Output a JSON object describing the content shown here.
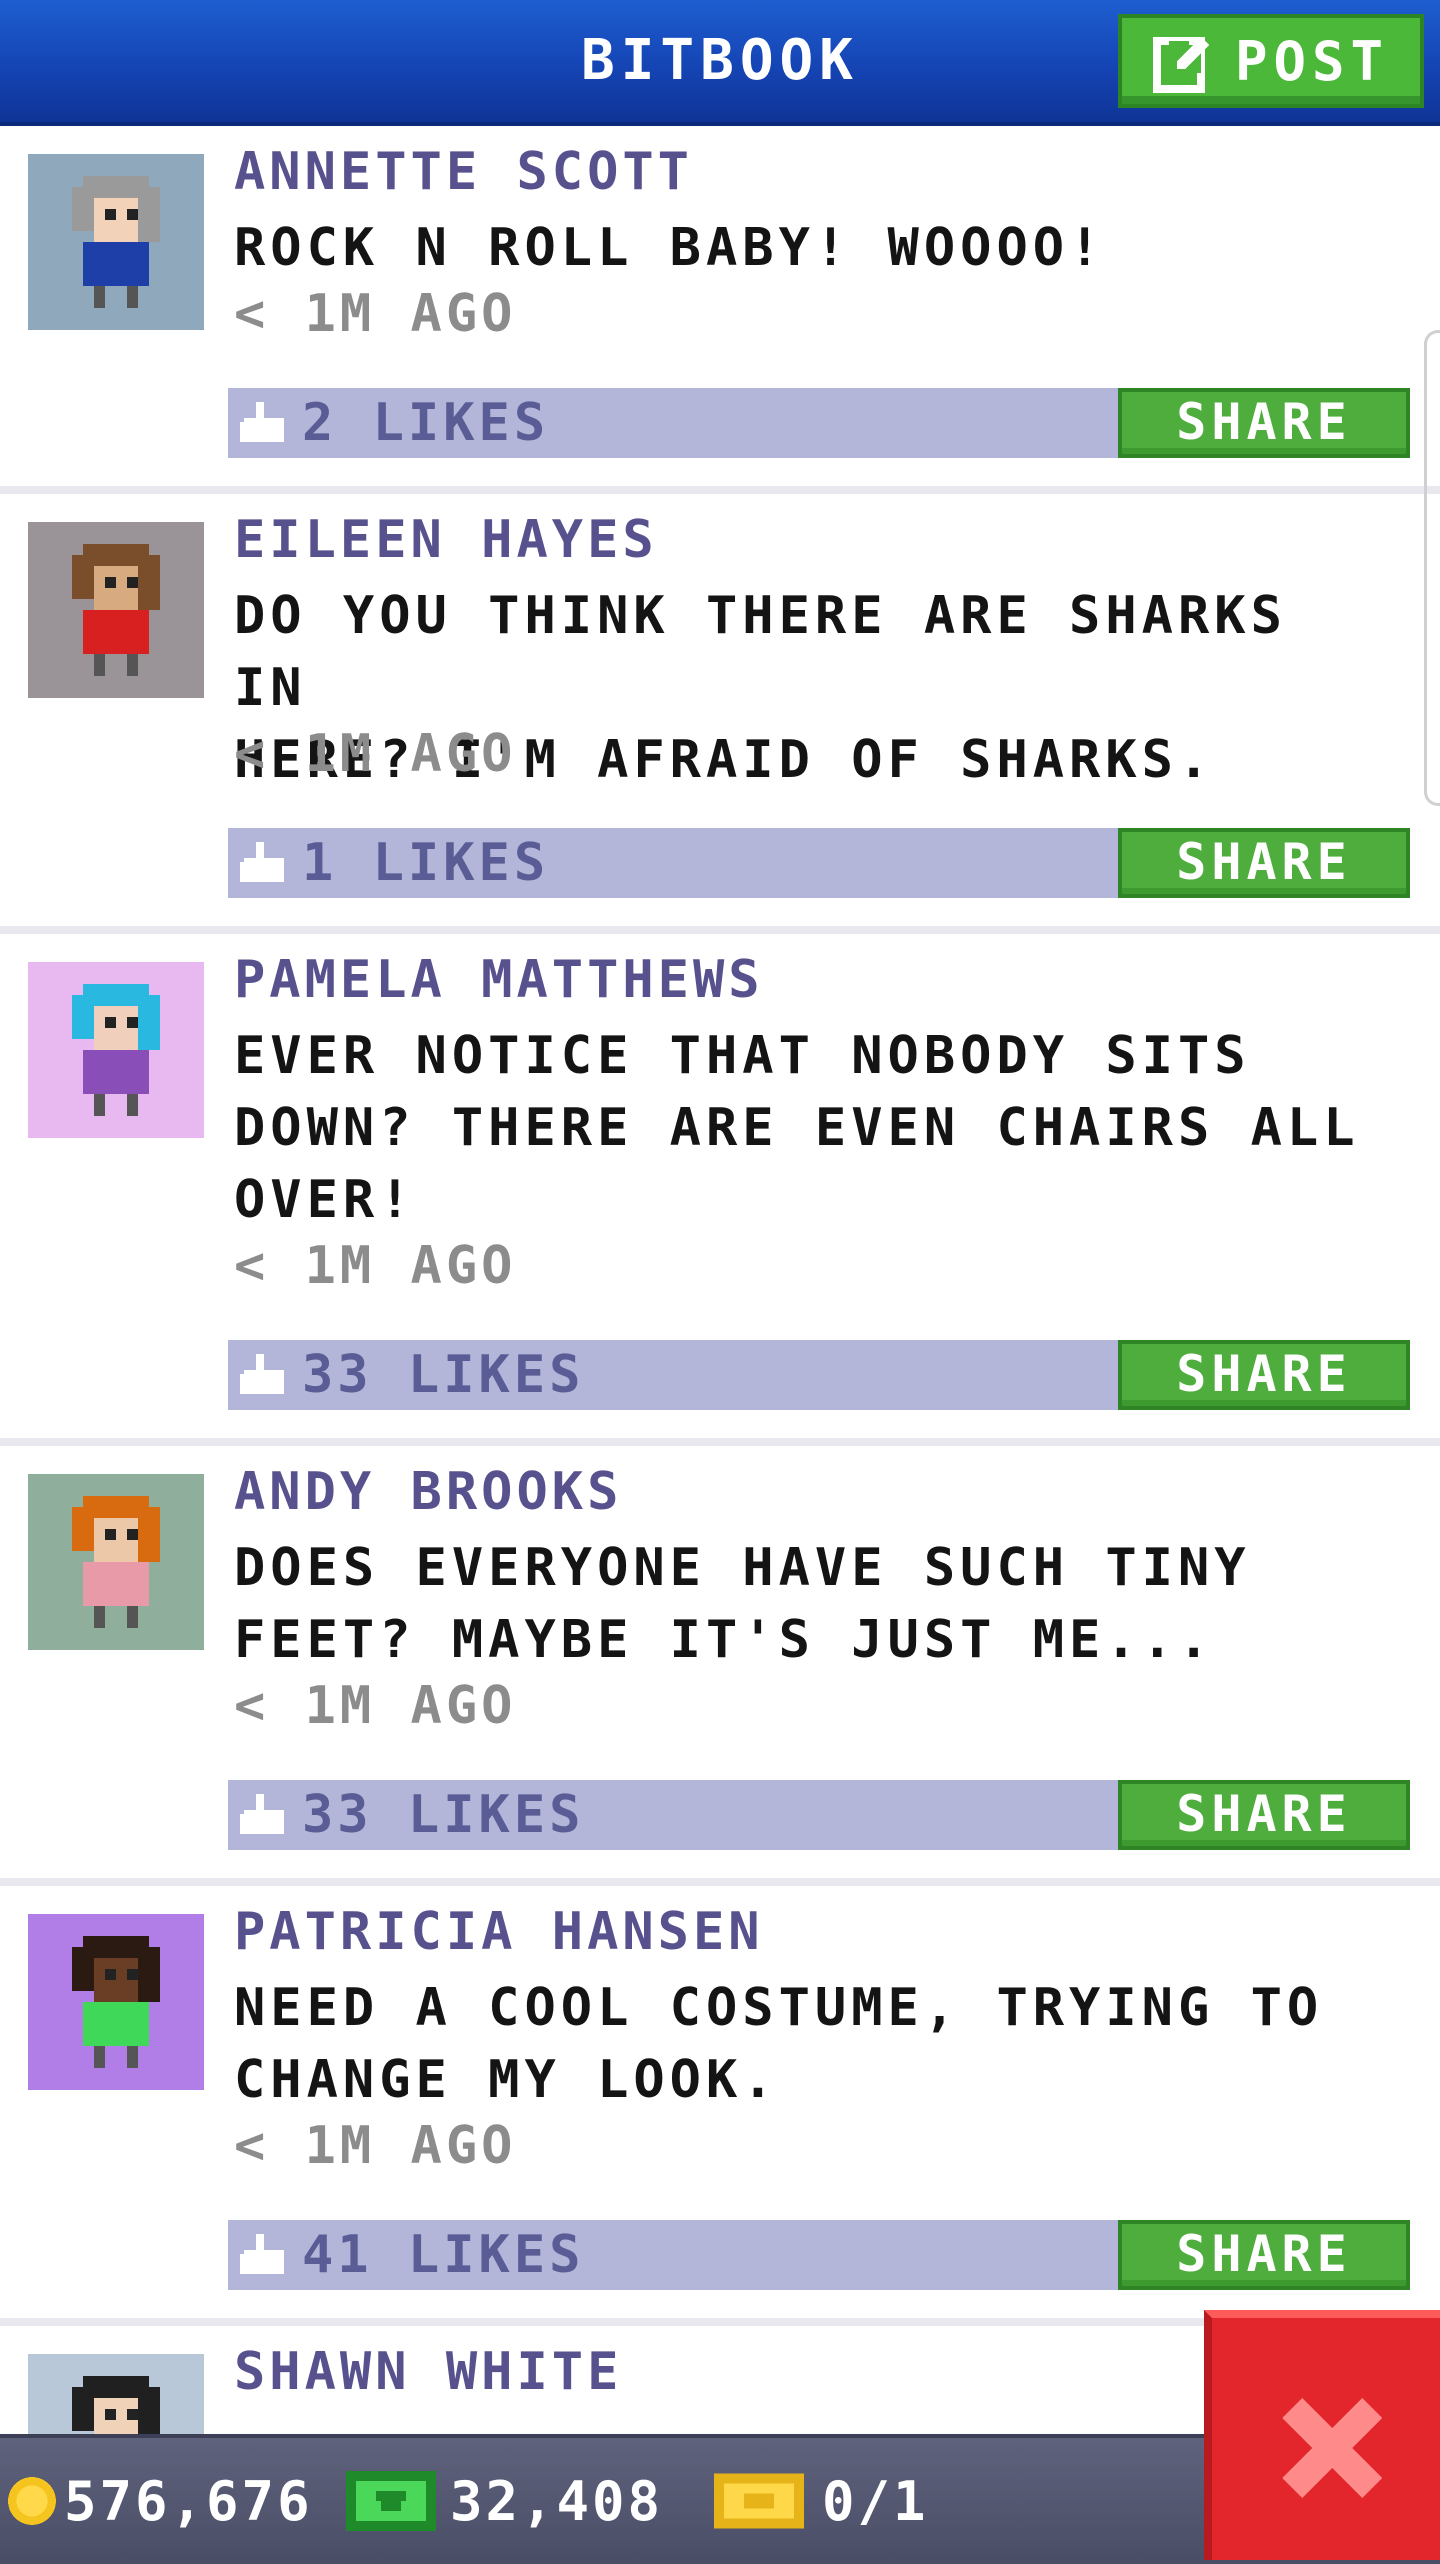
{
  "header": {
    "title": "BITBOOK",
    "post_label": "POST",
    "post_icon": "edit-icon"
  },
  "posts": [
    {
      "name": "ANNETTE SCOTT",
      "message": "ROCK N ROLL BABY! WOOOO!",
      "time": "< 1M AGO",
      "likes": "2 LIKES",
      "share": "SHARE",
      "avatar_bg": "#8fa8bc",
      "hair": "#9a9a9a",
      "skin": "#f2d2b8",
      "shirt": "#1e3fa8"
    },
    {
      "name": "EILEEN HAYES",
      "message": "DO YOU THINK THERE ARE SHARKS IN\nHERE? I'M AFRAID OF SHARKS.",
      "time": "< 1M AGO",
      "likes": "1 LIKES",
      "share": "SHARE",
      "avatar_bg": "#9a9498",
      "hair": "#7a4e2a",
      "skin": "#d8aa80",
      "shirt": "#d82020"
    },
    {
      "name": "PAMELA MATTHEWS",
      "message": "EVER NOTICE THAT NOBODY SITS\nDOWN? THERE ARE EVEN CHAIRS ALL\nOVER!",
      "time": "< 1M AGO",
      "likes": "33 LIKES",
      "share": "SHARE",
      "avatar_bg": "#e8b8f0",
      "hair": "#28b8e0",
      "skin": "#f0d0bc",
      "shirt": "#8a4eb8"
    },
    {
      "name": "ANDY BROOKS",
      "message": "DOES EVERYONE HAVE SUCH TINY\nFEET? MAYBE IT'S JUST ME...",
      "time": "< 1M AGO",
      "likes": "33 LIKES",
      "share": "SHARE",
      "avatar_bg": "#8fae9c",
      "hair": "#d86a10",
      "skin": "#ecc8a8",
      "shirt": "#e89aa8"
    },
    {
      "name": "PATRICIA HANSEN",
      "message": "NEED A COOL COSTUME, TRYING TO\nCHANGE MY LOOK.",
      "time": "< 1M AGO",
      "likes": "41 LIKES",
      "share": "SHARE",
      "avatar_bg": "#b07ee6",
      "hair": "#2a1a12",
      "skin": "#6a3e24",
      "shirt": "#40d858"
    },
    {
      "name": "SHAWN WHITE",
      "message": "",
      "time": "",
      "likes": "",
      "share": "",
      "avatar_bg": "#b8c8d8",
      "hair": "#202020",
      "skin": "#f0d2b8",
      "shirt": "#3050a0"
    }
  ],
  "status": {
    "coins": "576,676",
    "bux": "32,408",
    "tickets": "0/1"
  },
  "colors": {
    "header": "#1544b4",
    "share_green": "#4ead3c",
    "likes_bar": "#b3b6d8",
    "close_red": "#e2262b"
  }
}
